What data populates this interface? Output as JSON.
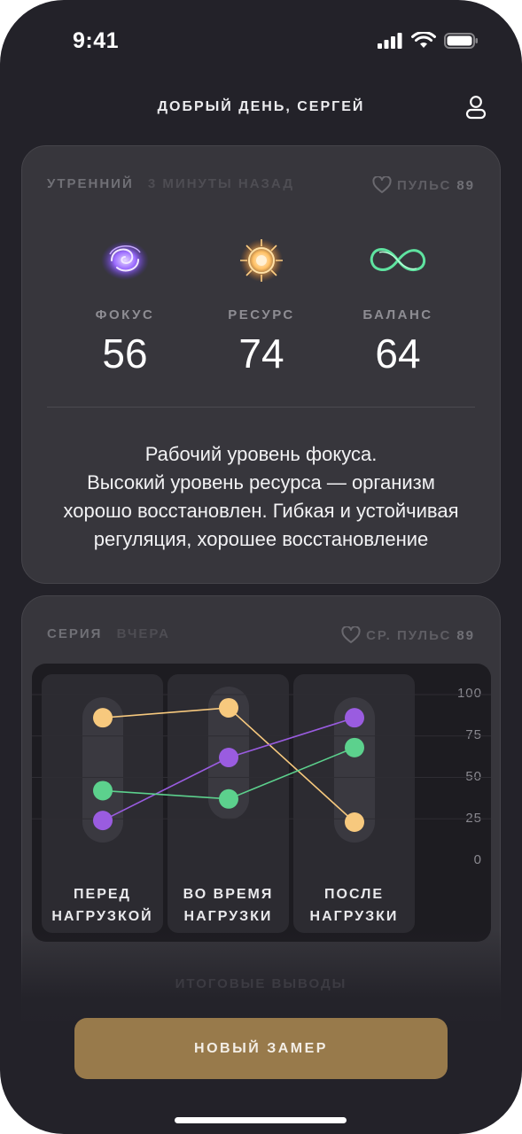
{
  "status_bar": {
    "time": "9:41"
  },
  "header": {
    "greeting": "ДОБРЫЙ ДЕНЬ, СЕРГЕЙ"
  },
  "morning_card": {
    "title": "УТРЕННИЙ",
    "subtitle": "3 МИНУТЫ НАЗАД",
    "pulse_label": "ПУЛЬС",
    "pulse_value": "89",
    "metrics": [
      {
        "label": "ФОКУС",
        "value": "56",
        "icon": "focus-brain-icon",
        "color": "#8a5cf6"
      },
      {
        "label": "РЕСУРС",
        "value": "74",
        "icon": "resource-sun-icon",
        "color": "#f0b45a"
      },
      {
        "label": "БАЛАНС",
        "value": "64",
        "icon": "balance-infinity-icon",
        "color": "#4fd38a"
      }
    ],
    "summary": [
      "Рабочий уровень фокуса.",
      "Высокий уровень ресурса  — организм",
      "хорошо восстановлен. Гибкая и устойчивая",
      "регуляция, хорошее восстановление"
    ]
  },
  "series_card": {
    "title": "СЕРИЯ",
    "subtitle": "ВЧЕРА",
    "pulse_label": "СР. ПУЛЬС",
    "pulse_value": "89"
  },
  "chart_data": {
    "type": "line",
    "categories": [
      "ПЕРЕД НАГРУЗКОЙ",
      "ВО ВРЕМЯ НАГРУЗКИ",
      "ПОСЛЕ НАГРУЗКИ"
    ],
    "category_lines": [
      [
        "ПЕРЕД",
        "НАГРУЗКОЙ"
      ],
      [
        "ВО ВРЕМЯ",
        "НАГРУЗКИ"
      ],
      [
        "ПОСЛЕ",
        "НАГРУЗКИ"
      ]
    ],
    "y_ticks": [
      "100",
      "75",
      "50",
      "25",
      "0"
    ],
    "ylim": [
      0,
      100
    ],
    "series": [
      {
        "key": "resource",
        "values": [
          86,
          92,
          23
        ],
        "color": "#f7c97e"
      },
      {
        "key": "focus",
        "values": [
          24,
          62,
          86
        ],
        "color": "#9a5ce0"
      },
      {
        "key": "balance",
        "values": [
          42,
          37,
          68
        ],
        "color": "#5cd18d"
      }
    ]
  },
  "footer": {
    "conclusions_label": "ИТОГОВЫЕ ВЫВОДЫ",
    "new_measure_button": "НОВЫЙ ЗАМЕР"
  }
}
